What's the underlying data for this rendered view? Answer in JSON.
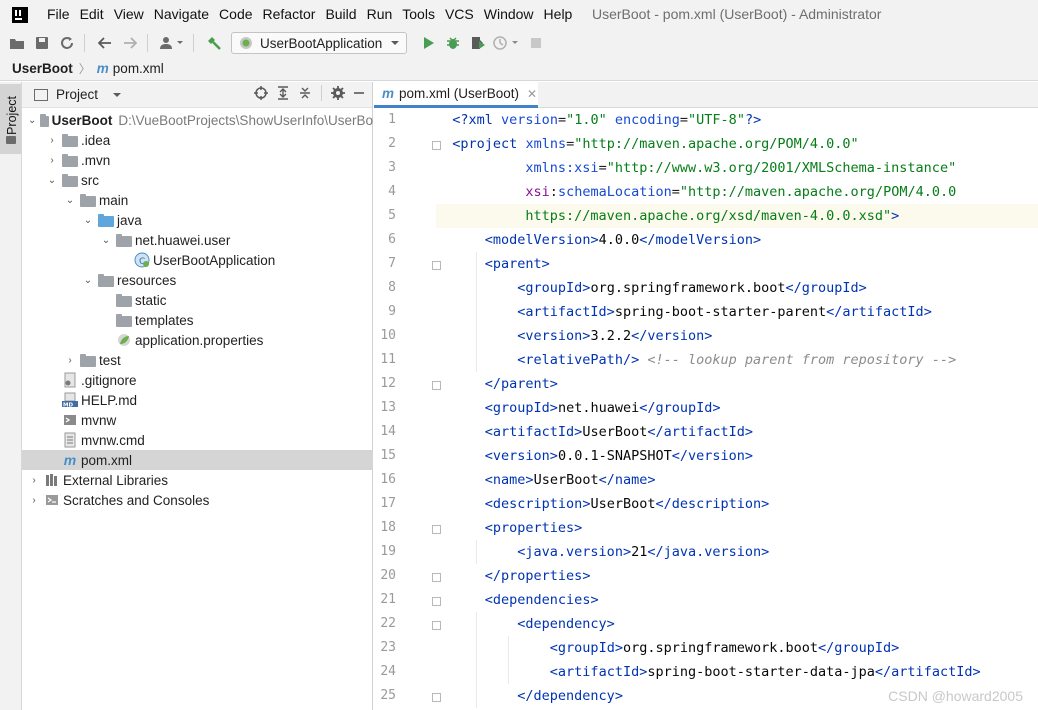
{
  "menu": [
    "File",
    "Edit",
    "View",
    "Navigate",
    "Code",
    "Refactor",
    "Build",
    "Run",
    "Tools",
    "VCS",
    "Window",
    "Help"
  ],
  "window_title": "UserBoot - pom.xml (UserBoot) - Administrator",
  "toolbar": {
    "run_config": "UserBootApplication"
  },
  "breadcrumb": {
    "project": "UserBoot",
    "file": "pom.xml"
  },
  "left_stripe": {
    "tab": "Project"
  },
  "project_panel": {
    "title": "Project",
    "root": {
      "name": "UserBoot",
      "path": "D:\\VueBootProjects\\ShowUserInfo\\UserBo"
    },
    "items": [
      ".idea",
      ".mvn",
      "src",
      "main",
      "java",
      "net.huawei.user",
      "UserBootApplication",
      "resources",
      "static",
      "templates",
      "application.properties",
      "test",
      ".gitignore",
      "HELP.md",
      "mvnw",
      "mvnw.cmd",
      "pom.xml",
      "External Libraries",
      "Scratches and Consoles"
    ]
  },
  "editor": {
    "tab_label": "pom.xml (UserBoot)",
    "line_numbers": [
      "1",
      "2",
      "3",
      "4",
      "5",
      "6",
      "7",
      "8",
      "9",
      "10",
      "11",
      "12",
      "13",
      "14",
      "15",
      "16",
      "17",
      "18",
      "19",
      "20",
      "21",
      "22",
      "23",
      "24",
      "25"
    ],
    "current_line": 5
  },
  "watermark": "CSDN @howard2005"
}
